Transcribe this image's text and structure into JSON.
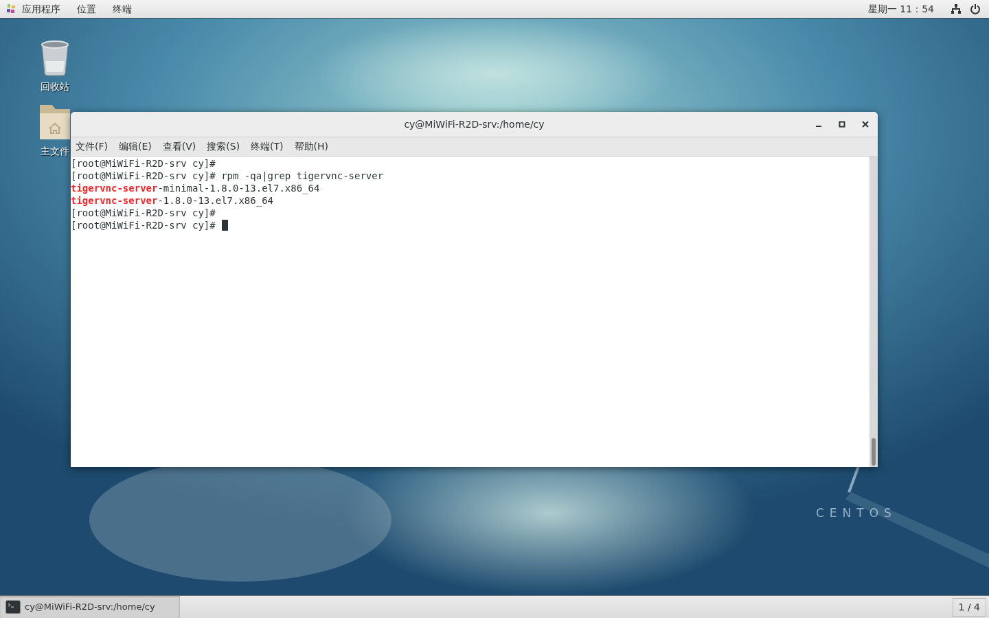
{
  "top_bar": {
    "menus": [
      "应用程序",
      "位置",
      "终端"
    ],
    "clock": "星期一 11：54"
  },
  "desktop": {
    "icons": [
      {
        "kind": "trash",
        "label": "回收站"
      },
      {
        "kind": "folder",
        "label": "主文件"
      }
    ],
    "wallpaper_brand": "CENTOS"
  },
  "window": {
    "title": "cy@MiWiFi-R2D-srv:/home/cy",
    "menus": [
      "文件(F)",
      "编辑(E)",
      "查看(V)",
      "搜索(S)",
      "终端(T)",
      "帮助(H)"
    ],
    "lines": [
      {
        "segments": [
          {
            "text": "[root@MiWiFi-R2D-srv cy]#",
            "highlight": false
          }
        ],
        "cursor": false
      },
      {
        "segments": [
          {
            "text": "[root@MiWiFi-R2D-srv cy]# rpm -qa|grep tigervnc-server",
            "highlight": false
          }
        ],
        "cursor": false
      },
      {
        "segments": [
          {
            "text": "tigervnc-server",
            "highlight": true
          },
          {
            "text": "-minimal-1.8.0-13.el7.x86_64",
            "highlight": false
          }
        ],
        "cursor": false
      },
      {
        "segments": [
          {
            "text": "tigervnc-server",
            "highlight": true
          },
          {
            "text": "-1.8.0-13.el7.x86_64",
            "highlight": false
          }
        ],
        "cursor": false
      },
      {
        "segments": [
          {
            "text": "[root@MiWiFi-R2D-srv cy]#",
            "highlight": false
          }
        ],
        "cursor": false
      },
      {
        "segments": [
          {
            "text": "[root@MiWiFi-R2D-srv cy]#",
            "highlight": false
          }
        ],
        "cursor": true
      }
    ]
  },
  "taskbar": {
    "tasks": [
      {
        "label": "cy@MiWiFi-R2D-srv:/home/cy",
        "selected": true
      }
    ],
    "workspace": "1 / 4"
  }
}
